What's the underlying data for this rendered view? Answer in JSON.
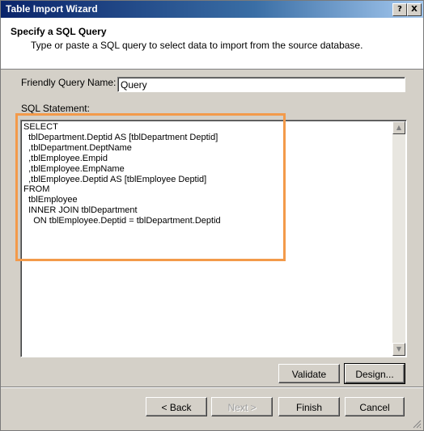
{
  "window": {
    "title": "Table Import Wizard",
    "help_glyph": "?",
    "close_glyph": "X"
  },
  "header": {
    "title": "Specify a SQL Query",
    "subtitle": "Type or paste a SQL query to select data to import from the source database."
  },
  "form": {
    "friendly_name_label": "Friendly Query Name:",
    "friendly_name_value": "Query",
    "sql_label": "SQL Statement:",
    "sql_lines": [
      "SELECT",
      "  tblDepartment.Deptid AS [tblDepartment Deptid]",
      "  ,tblDepartment.DeptName",
      "  ,tblEmployee.Empid",
      "  ,tblEmployee.EmpName",
      "  ,tblEmployee.Deptid AS [tblEmployee Deptid]",
      "FROM",
      "  tblEmployee",
      "  INNER JOIN tblDepartment",
      "    ON tblEmployee.Deptid = tblDepartment.Deptid"
    ]
  },
  "scroll": {
    "up_glyph": "▲",
    "down_glyph": "▼"
  },
  "buttons": {
    "validate": "Validate",
    "design": "Design...",
    "back": "< Back",
    "next": "Next >",
    "finish": "Finish",
    "cancel": "Cancel"
  },
  "colors": {
    "highlight": "#f39a4a"
  }
}
